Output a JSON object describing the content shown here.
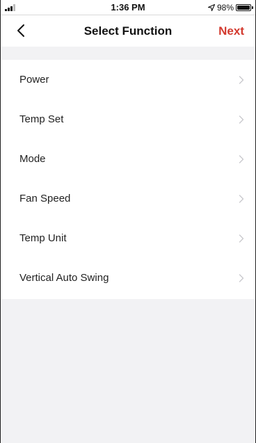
{
  "status_bar": {
    "time": "1:36 PM",
    "battery_text": "98%",
    "battery_level": 0.98,
    "signal_icon": "signal-icon",
    "location_icon": "location-arrow-icon",
    "battery_icon": "battery-icon"
  },
  "nav": {
    "title": "Select Function",
    "next_label": "Next",
    "back_icon": "chevron-left-icon",
    "accent_color": "#d33a2f"
  },
  "functions": [
    {
      "label": "Power"
    },
    {
      "label": "Temp Set"
    },
    {
      "label": "Mode"
    },
    {
      "label": "Fan Speed"
    },
    {
      "label": "Temp Unit"
    },
    {
      "label": "Vertical Auto Swing"
    }
  ],
  "colors": {
    "background": "#f2f2f4",
    "list_background": "#ffffff",
    "chevron": "#c7c7cc"
  }
}
